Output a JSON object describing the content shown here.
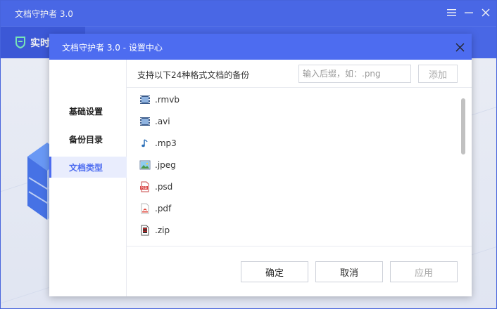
{
  "app": {
    "title": "文档守护者 3.0",
    "tab_label": "实时",
    "window_controls": [
      "menu-icon",
      "minimize-icon",
      "close-icon"
    ]
  },
  "dialog": {
    "title": "文档守护者 3.0 - 设置中心",
    "nav": [
      {
        "label": "基础设置",
        "active": false
      },
      {
        "label": "备份目录",
        "active": false
      },
      {
        "label": "文档类型",
        "active": true
      }
    ],
    "hint": "支持以下24种格式文档的备份",
    "ext_input": {
      "value": "",
      "placeholder": "输入后缀，如：.png"
    },
    "add_label": "添加",
    "files": [
      {
        "name": ".rmvb",
        "icon": "video-file-icon"
      },
      {
        "name": ".avi",
        "icon": "video-file-icon"
      },
      {
        "name": ".mp3",
        "icon": "music-file-icon"
      },
      {
        "name": ".jpeg",
        "icon": "image-file-icon"
      },
      {
        "name": ".psd",
        "icon": "psd-file-icon"
      },
      {
        "name": ".pdf",
        "icon": "pdf-file-icon"
      },
      {
        "name": ".zip",
        "icon": "zip-file-icon"
      }
    ],
    "buttons": {
      "ok": "确定",
      "cancel": "取消",
      "apply": "应用"
    }
  },
  "colors": {
    "accent": "#4d6cf0",
    "nav_active_bg": "#e9edfd",
    "disabled_text": "#aaaaaa"
  }
}
